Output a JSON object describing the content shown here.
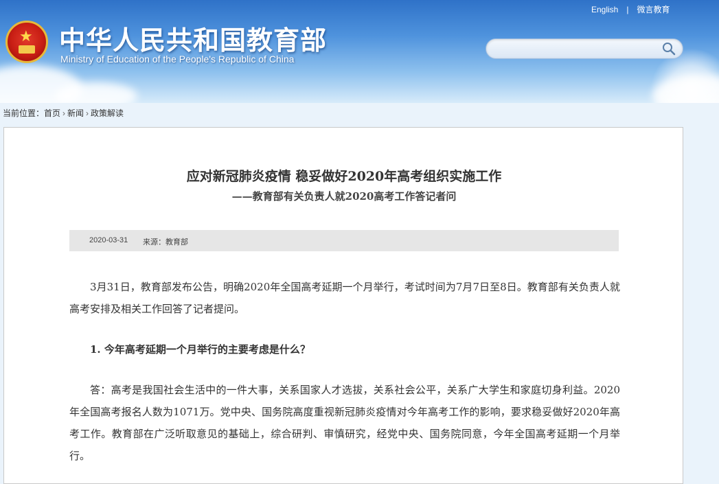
{
  "header": {
    "title": "中华人民共和国教育部",
    "subtitle": "Ministry of Education of the People's Republic of China",
    "links": [
      "English",
      "微言教育"
    ],
    "link_separator": "|",
    "search_placeholder": ""
  },
  "breadcrumb": {
    "prefix": "当前位置：",
    "items": [
      "首页",
      "新闻",
      "政策解读"
    ]
  },
  "article": {
    "title": "应对新冠肺炎疫情 稳妥做好2020年高考组织实施工作",
    "subtitle": "——教育部有关负责人就2020高考工作答记者问",
    "date": "2020-03-31",
    "source": "来源：教育部",
    "paragraphs": [
      "3月31日，教育部发布公告，明确2020年全国高考延期一个月举行，考试时间为7月7日至8日。教育部有关负责人就高考安排及相关工作回答了记者提问。",
      "1. 今年高考延期一个月举行的主要考虑是什么？",
      "答：高考是我国社会生活中的一件大事，关系国家人才选拔，关系社会公平，关系广大学生和家庭切身利益。2020年全国高考报名人数为1071万。党中央、国务院高度重视新冠肺炎疫情对今年高考工作的影响，要求稳妥做好2020年高考工作。教育部在广泛听取意见的基础上，综合研判、审慎研究，经党中央、国务院同意，今年全国高考延期一个月举行。"
    ]
  },
  "colors": {
    "header_top": "#2f72c8",
    "panel_bg": "#ffffff",
    "meta_bg": "#e6e6e6",
    "text": "#333333"
  }
}
